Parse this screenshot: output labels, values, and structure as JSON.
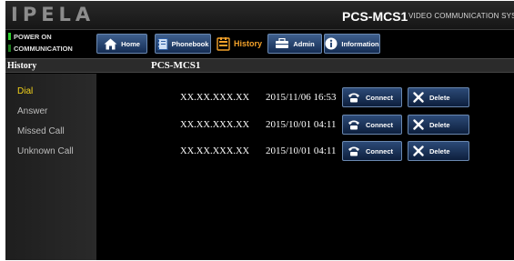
{
  "app": {
    "logo": "IPELA",
    "model": "PCS-MCS1",
    "subtitle": "VIDEO COMMUNICATION SYSTEM"
  },
  "status": {
    "power": "POWER ON",
    "communication": "COMMUNICATION"
  },
  "nav": {
    "home": "Home",
    "phonebook": "Phonebook",
    "history": "History",
    "admin": "Admin",
    "information": "Information"
  },
  "section": {
    "title": "History",
    "device": "PCS-MCS1"
  },
  "sidebar": {
    "items": [
      {
        "label": "Dial",
        "active": true
      },
      {
        "label": "Answer",
        "active": false
      },
      {
        "label": "Missed Call",
        "active": false
      },
      {
        "label": "Unknown Call",
        "active": false
      }
    ]
  },
  "history": {
    "rows": [
      {
        "address": "XX.XX.XXX.XX",
        "datetime": "2015/11/06 16:53",
        "connect": "Connect",
        "delete": "Delete"
      },
      {
        "address": "XX.XX.XXX.XX",
        "datetime": "2015/10/01 04:11",
        "connect": "Connect",
        "delete": "Delete"
      },
      {
        "address": "XX.XX.XXX.XX",
        "datetime": "2015/10/01 04:11",
        "connect": "Connect",
        "delete": "Delete"
      }
    ]
  },
  "colors": {
    "background": "#000000",
    "accent_active": "#f2d21a",
    "history_tab": "#f2a12a",
    "button_blue": "#2c4a77",
    "led_green": "#2fd32f"
  },
  "icons": {
    "home": "home-icon",
    "phonebook": "phonebook-icon",
    "history": "history-icon",
    "admin": "admin-icon",
    "information": "information-icon",
    "connect": "phone-icon",
    "delete": "x-icon"
  }
}
